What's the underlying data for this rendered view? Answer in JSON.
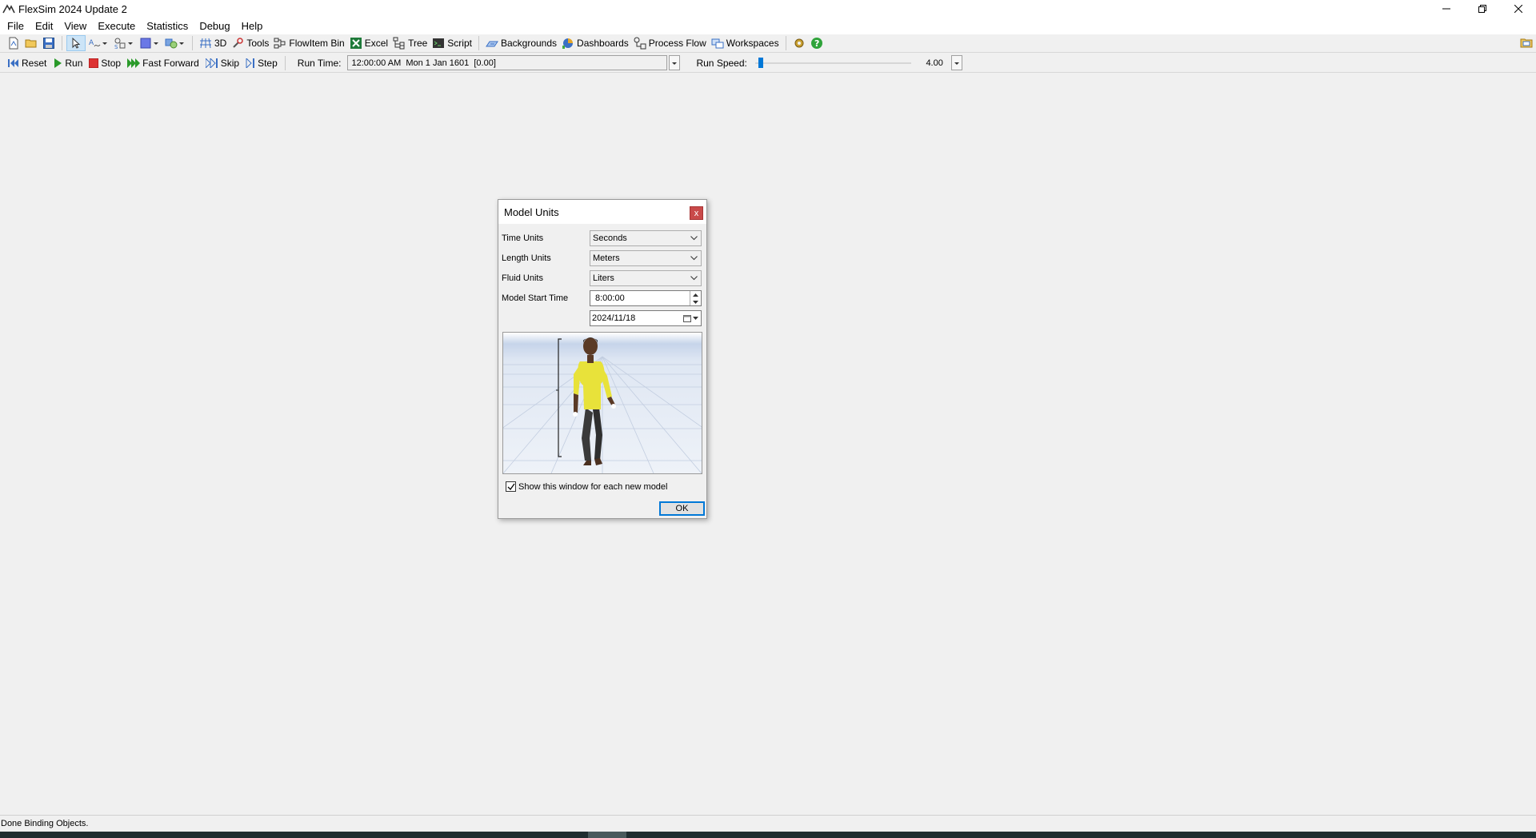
{
  "window": {
    "title": "FlexSim 2024 Update 2",
    "minimize_icon": "minimize-icon",
    "restore_icon": "restore-icon",
    "close_icon": "close-icon"
  },
  "menu": {
    "items": [
      "File",
      "Edit",
      "View",
      "Execute",
      "Statistics",
      "Debug",
      "Help"
    ]
  },
  "toolbar": {
    "view_3d": "3D",
    "tools": "Tools",
    "flowitem_bin": "FlowItem Bin",
    "excel": "Excel",
    "tree": "Tree",
    "script": "Script",
    "backgrounds": "Backgrounds",
    "dashboards": "Dashboards",
    "process_flow": "Process Flow",
    "workspaces": "Workspaces"
  },
  "runbar": {
    "reset": "Reset",
    "run": "Run",
    "stop": "Stop",
    "fast_forward": "Fast Forward",
    "skip": "Skip",
    "step": "Step",
    "run_time_label": "Run Time:",
    "run_time_value": "12:00:00 AM  Mon 1 Jan 1601  [0.00]",
    "run_speed_label": "Run Speed:",
    "run_speed_value": "4.00",
    "run_speed_fraction": 0.02
  },
  "dialog": {
    "title": "Model Units",
    "close": "x",
    "time_units_label": "Time Units",
    "time_units_value": "Seconds",
    "length_units_label": "Length Units",
    "length_units_value": "Meters",
    "fluid_units_label": "Fluid Units",
    "fluid_units_value": "Liters",
    "start_time_label": "Model Start Time",
    "start_time_value": "8:00:00",
    "start_date_value": "2024/11/18",
    "show_window_label": "Show this window for each new model",
    "show_window_checked": true,
    "ok": "OK"
  },
  "status": {
    "text": "Done Binding Objects."
  },
  "colors": {
    "accent": "#0078d7",
    "close_red": "#c94a4a",
    "shirt_yellow": "#e8e23a"
  }
}
